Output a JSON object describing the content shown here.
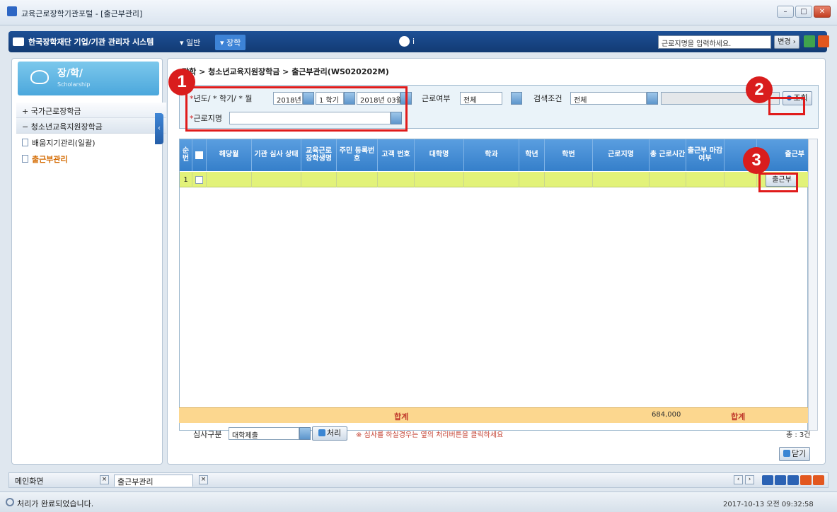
{
  "window": {
    "title": "교육근로장학기관포털 - [출근부관리]"
  },
  "topnav": {
    "brand": "한국장학재단 기업/기관 관리자 시스템",
    "menu_general": "▾ 일반",
    "menu_scholarship": "▾ 장학",
    "search_placeholder": "근로지명을 입력하세요.",
    "change_button": "변경 ›"
  },
  "sidebar": {
    "title": "장/학/",
    "subtitle": "Scholarship",
    "groups": [
      {
        "label": "+ 국가근로장학금"
      },
      {
        "label": "− 청소년교육지원장학금"
      }
    ],
    "items": [
      {
        "label": "배움지기관리(일괄)"
      },
      {
        "label": "출근부관리"
      }
    ]
  },
  "breadcrumb": "장학 > 청소년교육지원장학금 > 출근부관리(WS020202M)",
  "filter": {
    "year_term_month_label": "년도/ * 학기/ * 월",
    "year_value": "2018년",
    "term_value": "1 학기",
    "month_value": "2018년 03월",
    "work_label": "근로여부",
    "work_value": "전체",
    "search_cond_label": "검색조건",
    "search_cond_value": "전체",
    "workplace_label": "근로지명",
    "query_button": "조회"
  },
  "grid": {
    "headers": [
      "순번",
      "",
      "해당월",
      "기관 심사 상태",
      "교육근로 장학생명",
      "주민 등록번호",
      "고객 번호",
      "대학명",
      "학과",
      "학년",
      "학번",
      "근로지명",
      "총 근로시간",
      "출근부 마감여부",
      "",
      "출근부"
    ],
    "rows": [
      {
        "no": "1",
        "button": "출근부"
      }
    ],
    "total_label": "합계",
    "total_hours": "684,000",
    "total_label2": "합계"
  },
  "footer": {
    "review_label": "심사구분",
    "review_value": "대학제출",
    "process_button": "처리",
    "note": "※ 심사를 하실경우는 옆의 처리버튼을 클릭하세요",
    "count": "총 : 3건",
    "close_button": "닫기"
  },
  "tabs": [
    {
      "label": "메인화면"
    },
    {
      "label": "출근부관리"
    }
  ],
  "status": {
    "message": "처리가 완료되었습니다.",
    "datetime": "2017-10-13 오전 09:32:58"
  },
  "callouts": [
    "1",
    "2",
    "3"
  ],
  "colors": {
    "accent": "#357fca",
    "row_highlight": "#e2f279",
    "callout": "#d91d1d",
    "total_row": "#fcd78f"
  }
}
